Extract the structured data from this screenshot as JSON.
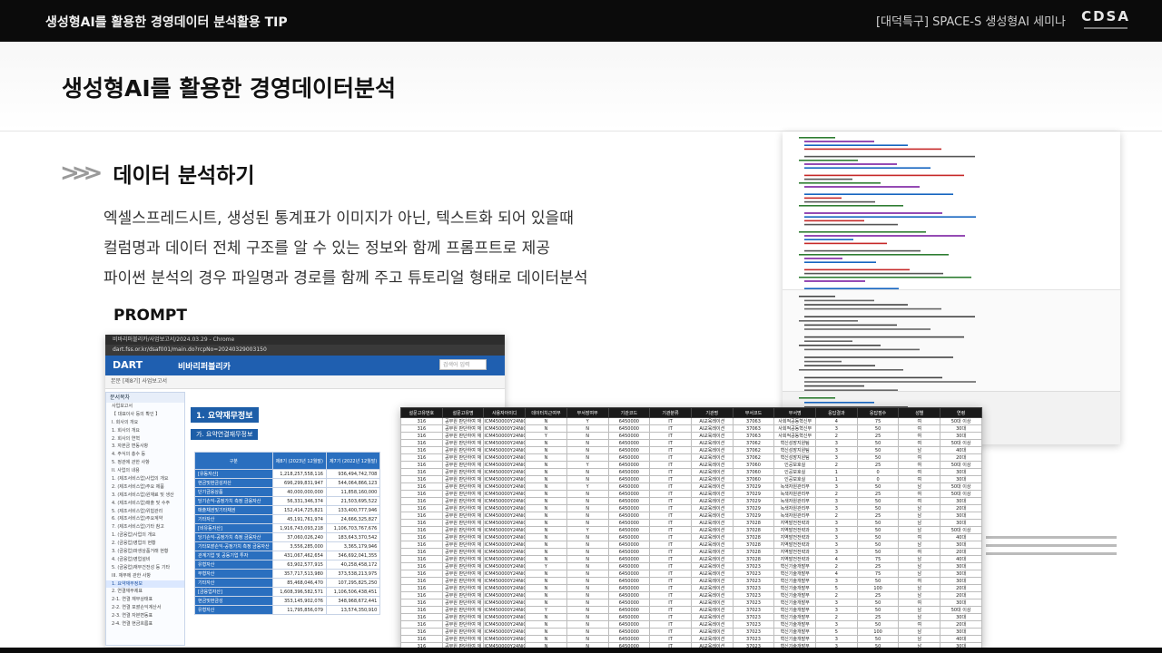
{
  "header": {
    "title": "생성형AI를 활용한 경영데이터 분석활용 TIP",
    "event": "[대덕특구] SPACE-S 생성형AI 세미나",
    "logo": "CDSA"
  },
  "page": {
    "title": "생성형AI를 활용한 경영데이터분석",
    "section_title": "데이터 분석하기",
    "lines": [
      "엑셀스프레드시트, 생성된 통계표가 이미지가 아닌, 텍스트화 되어 있을때",
      "컬럼명과 데이터 전체 구조를 알 수 있는 정보와 함께 프롬프트로 제공",
      "파이썬 분석의 경우 파일명과 경로를 함께 주고 튜토리얼 형태로 데이터분석"
    ],
    "prompt_label": "PROMPT"
  },
  "dart": {
    "window_title": "비바리퍼블리카/사업보고서/2024.03.29 - Chrome",
    "url": "dart.fss.or.kr/dsaf001/main.do?rcpNo=20240329003150",
    "logo": "DART",
    "company": "비바리퍼블리카",
    "search_placeholder": "검색어 입력",
    "filter_text": "본문 [제8기] 사업보고서",
    "sidebar_title": "문서목차",
    "tree": [
      "사업보고서",
      "【 대표이사 등의 확인 】",
      "I. 회사의 개요",
      "1. 회사의 개요",
      "2. 회사의 연혁",
      "3. 자본금 변동사항",
      "4. 주식의 총수 등",
      "5. 정관에 관한 사항",
      "II. 사업의 내용",
      "1. (제조서비스업)사업의 개요",
      "2. (제조서비스업)주요 제품",
      "3. (제조서비스업)원재료 및 생산",
      "4. (제조서비스업)매출 및 수주",
      "5. (제조서비스업)위험관리",
      "6. (제조서비스업)주요계약",
      "7. (제조서비스업)기타 참고",
      "1. (금융업)사업의 개요",
      "2. (금융업)영업의 현황",
      "3. (금융업)파생상품거래 현황",
      "4. (금융업)영업설비",
      "5. (금융업)재무건전성 등 기타",
      "III. 재무에 관한 사항",
      "1. 요약재무정보",
      "2. 연결재무제표",
      "2-1. 연결 재무상태표",
      "2-2. 연결 포괄손익계산서",
      "2-3. 연결 자본변동표",
      "2-4. 연결 현금흐름표"
    ],
    "fin_title": "1. 요약재무정보",
    "fin_subtitle": "가. 요약연결재무정보",
    "fin_header": [
      "구분",
      "제8기 (2023년 12월말)",
      "제7기 (2022년 12월말)"
    ],
    "fin_rows": [
      [
        "[유동자산]",
        "1,218,257,558,116",
        "936,494,742,708"
      ],
      [
        "현금및현금성자산",
        "696,299,831,947",
        "544,064,866,123"
      ],
      [
        "단기금융상품",
        "40,000,000,000",
        "11,858,160,000"
      ],
      [
        "당기손익-공정가치 측정 금융자산",
        "56,331,346,374",
        "21,503,695,522"
      ],
      [
        "매출채권및기타채권",
        "152,414,725,821",
        "133,400,777,946"
      ],
      [
        "기타자산",
        "45,191,761,974",
        "24,666,325,827"
      ],
      [
        "[비유동자산]",
        "1,916,743,093,218",
        "1,106,703,767,676"
      ],
      [
        "당기손익-공정가치 측정 금융자산",
        "37,060,026,240",
        "183,643,370,542"
      ],
      [
        "기타포괄손익-공정가치 측정 금융자산",
        "3,556,285,000",
        "3,365,179,946"
      ],
      [
        "관계기업 및 공동기업 투자",
        "431,067,462,654",
        "346,692,041,355"
      ],
      [
        "유형자산",
        "63,902,577,915",
        "40,258,458,172"
      ],
      [
        "무형자산",
        "357,717,513,980",
        "373,538,213,975"
      ],
      [
        "기타자산",
        "85,468,046,470",
        "107,295,825,250"
      ],
      [
        "[금융업자산]",
        "1,608,396,582,571",
        "1,106,506,438,451"
      ],
      [
        "현금및현금성",
        "353,145,902,076",
        "348,968,672,441"
      ],
      [
        "유형자산",
        "11,795,856,079",
        "13,574,350,910"
      ]
    ]
  },
  "sheet": {
    "columns": [
      "설문고유번호",
      "설문고유명",
      "사용자아이디",
      "데이터치근여부",
      "부서장여부",
      "기관코드",
      "기관분류",
      "기관명",
      "부서코드",
      "부서명",
      "응답결과",
      "응답점수",
      "성별",
      "연령"
    ],
    "rows": [
      [
        "316",
        "공무원 판단하여 재",
        "ICM450000Y24Ni0000",
        "N",
        "Y",
        "6450000",
        "IT",
        "AI교육레이션",
        "37063",
        "사회적공동혁신부",
        "4",
        "75",
        "여",
        "50대 이상"
      ],
      [
        "316",
        "공무원 판단하여 재",
        "ICM450000Y24Ni0000",
        "N",
        "N",
        "6450000",
        "IT",
        "AI교육레이션",
        "37063",
        "사회적공동혁신부",
        "3",
        "50",
        "여",
        "30대"
      ],
      [
        "316",
        "공무원 판단하여 재",
        "ICM450000Y24Ni0000",
        "Y",
        "N",
        "6450000",
        "IT",
        "AI교육레이션",
        "37063",
        "사회적공동혁신부",
        "2",
        "25",
        "여",
        "30대"
      ],
      [
        "316",
        "공무원 판단하여 재",
        "ICM450000Y24Ni0000",
        "N",
        "N",
        "6450000",
        "IT",
        "AI교육레이션",
        "37062",
        "혁신성장지원팀",
        "3",
        "50",
        "여",
        "50대 이상"
      ],
      [
        "316",
        "공무원 판단하여 재",
        "ICM450000Y24Ni0000",
        "N",
        "N",
        "6450000",
        "IT",
        "AI교육레이션",
        "37062",
        "혁신성장지원팀",
        "3",
        "50",
        "남",
        "40대"
      ],
      [
        "316",
        "공무원 판단하여 재",
        "ICM450000Y24Ni0000",
        "N",
        "N",
        "6450000",
        "IT",
        "AI교육레이션",
        "37062",
        "혁신성장지원팀",
        "3",
        "50",
        "여",
        "20대"
      ],
      [
        "316",
        "공무원 판단하여 재",
        "ICM450000Y24Ni0000",
        "N",
        "Y",
        "6450000",
        "IT",
        "AI교육레이션",
        "37060",
        "인공보호실",
        "2",
        "25",
        "여",
        "50대 이상"
      ],
      [
        "316",
        "공무원 판단하여 재",
        "ICM450000Y24Ni0000",
        "N",
        "N",
        "6450000",
        "IT",
        "AI교육레이션",
        "37060",
        "인공보호실",
        "1",
        "0",
        "여",
        "30대"
      ],
      [
        "316",
        "공무원 판단하여 재",
        "ICM450000Y24Ni0000",
        "N",
        "N",
        "6450000",
        "IT",
        "AI교육레이션",
        "37060",
        "인공보호실",
        "1",
        "0",
        "여",
        "30대"
      ],
      [
        "316",
        "공무원 판단하여 재",
        "ICM450000Y24Ni0000",
        "N",
        "Y",
        "6450000",
        "IT",
        "AI교육레이션",
        "37029",
        "녹색자원관리부",
        "3",
        "50",
        "남",
        "50대 이상"
      ],
      [
        "316",
        "공무원 판단하여 재",
        "ICM450000Y24Ni0000",
        "N",
        "N",
        "6450000",
        "IT",
        "AI교육레이션",
        "37029",
        "녹색자원관리부",
        "2",
        "25",
        "여",
        "50대 이상"
      ],
      [
        "316",
        "공무원 판단하여 재",
        "ICM450000Y24Ni0000",
        "N",
        "N",
        "6450000",
        "IT",
        "AI교육레이션",
        "37029",
        "녹색자원관리부",
        "3",
        "50",
        "여",
        "30대"
      ],
      [
        "316",
        "공무원 판단하여 재",
        "ICM450000Y24Ni0000",
        "N",
        "N",
        "6450000",
        "IT",
        "AI교육레이션",
        "37029",
        "녹색자원관리부",
        "3",
        "50",
        "남",
        "20대"
      ],
      [
        "316",
        "공무원 판단하여 재",
        "ICM450000Y24Ni0000",
        "N",
        "N",
        "6450000",
        "IT",
        "AI교육레이션",
        "37029",
        "녹색자원관리부",
        "2",
        "25",
        "남",
        "30대"
      ],
      [
        "316",
        "공무원 판단하여 재",
        "ICM450000Y24Ni0000",
        "N",
        "N",
        "6450000",
        "IT",
        "AI교육레이션",
        "37028",
        "지역발전전략과",
        "3",
        "50",
        "남",
        "30대"
      ],
      [
        "316",
        "공무원 판단하여 재",
        "ICM450000Y24Ni0000",
        "N",
        "Y",
        "6450000",
        "IT",
        "AI교육레이션",
        "37028",
        "지역발전전략과",
        "3",
        "50",
        "남",
        "50대 이상"
      ],
      [
        "316",
        "공무원 판단하여 재",
        "ICM450000Y24Ni0000",
        "N",
        "N",
        "6450000",
        "IT",
        "AI교육레이션",
        "37028",
        "지역발전전략과",
        "3",
        "50",
        "여",
        "40대"
      ],
      [
        "316",
        "공무원 판단하여 재",
        "ICM450000Y24Ni0000",
        "N",
        "N",
        "6450000",
        "IT",
        "AI교육레이션",
        "37028",
        "지역발전전략과",
        "3",
        "50",
        "남",
        "30대"
      ],
      [
        "316",
        "공무원 판단하여 재",
        "ICM450000Y24Ni0000",
        "N",
        "N",
        "6450000",
        "IT",
        "AI교육레이션",
        "37028",
        "지역발전전략과",
        "3",
        "50",
        "여",
        "20대"
      ],
      [
        "316",
        "공무원 판단하여 재",
        "ICM450000Y24Ni0000",
        "N",
        "N",
        "6450000",
        "IT",
        "AI교육레이션",
        "37028",
        "지역발전전략과",
        "4",
        "75",
        "남",
        "40대"
      ],
      [
        "316",
        "공무원 판단하여 재",
        "ICM450000Y24Ni0000",
        "Y",
        "N",
        "6450000",
        "IT",
        "AI교육레이션",
        "37023",
        "혁신기술개발부",
        "2",
        "25",
        "남",
        "30대"
      ],
      [
        "316",
        "공무원 판단하여 재",
        "ICM450000Y24Ni0000",
        "N",
        "N",
        "6450000",
        "IT",
        "AI교육레이션",
        "37023",
        "혁신기술개발부",
        "4",
        "75",
        "남",
        "30대"
      ],
      [
        "316",
        "공무원 판단하여 재",
        "ICM450000Y24Ni0000",
        "N",
        "N",
        "6450000",
        "IT",
        "AI교육레이션",
        "37023",
        "혁신기술개발부",
        "3",
        "50",
        "여",
        "30대"
      ],
      [
        "316",
        "공무원 판단하여 재",
        "ICM450000Y24Ni0000",
        "N",
        "N",
        "6450000",
        "IT",
        "AI교육레이션",
        "37023",
        "혁신기술개발부",
        "5",
        "100",
        "남",
        "20대"
      ],
      [
        "316",
        "공무원 판단하여 재",
        "ICM450000Y24Ni0000",
        "N",
        "N",
        "6450000",
        "IT",
        "AI교육레이션",
        "37023",
        "혁신기술개발부",
        "2",
        "25",
        "남",
        "20대"
      ],
      [
        "316",
        "공무원 판단하여 재",
        "ICM450000Y24Ni0000",
        "N",
        "N",
        "6450000",
        "IT",
        "AI교육레이션",
        "37023",
        "혁신기술개발부",
        "3",
        "50",
        "여",
        "30대"
      ],
      [
        "316",
        "공무원 판단하여 재",
        "ICM450000Y24Ni0000",
        "Y",
        "N",
        "6450000",
        "IT",
        "AI교육레이션",
        "37023",
        "혁신기술개발부",
        "3",
        "50",
        "남",
        "50대 이상"
      ],
      [
        "316",
        "공무원 판단하여 재",
        "ICM450000Y24Ni0000",
        "N",
        "N",
        "6450000",
        "IT",
        "AI교육레이션",
        "37023",
        "혁신기술개발부",
        "2",
        "25",
        "남",
        "30대"
      ],
      [
        "316",
        "공무원 판단하여 재",
        "ICM450000Y24Ni0000",
        "N",
        "N",
        "6450000",
        "IT",
        "AI교육레이션",
        "37023",
        "혁신기술개발부",
        "3",
        "50",
        "여",
        "20대"
      ],
      [
        "316",
        "공무원 판단하여 재",
        "ICM450000Y24Ni0000",
        "N",
        "N",
        "6450000",
        "IT",
        "AI교육레이션",
        "37023",
        "혁신기술개발부",
        "5",
        "100",
        "남",
        "30대"
      ],
      [
        "316",
        "공무원 판단하여 재",
        "ICM450000Y24Ni0000",
        "N",
        "N",
        "6450000",
        "IT",
        "AI교육레이션",
        "37023",
        "혁신기술개발부",
        "3",
        "50",
        "남",
        "40대"
      ],
      [
        "316",
        "공무원 판단하여 재",
        "ICM450000Y24Ni0000",
        "N",
        "N",
        "6450000",
        "IT",
        "AI교육레이션",
        "37023",
        "혁신기술개발부",
        "3",
        "50",
        "남",
        "30대"
      ]
    ]
  }
}
